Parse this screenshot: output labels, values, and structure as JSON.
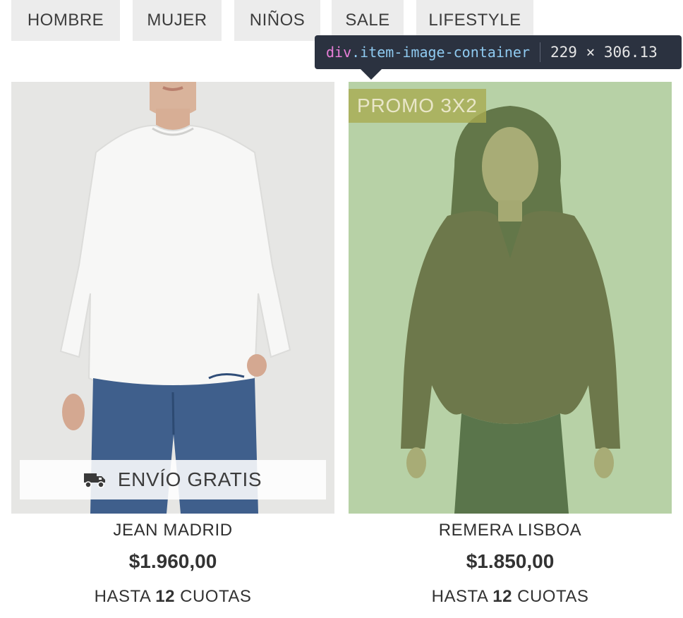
{
  "nav": {
    "items": [
      {
        "label": "HOMBRE"
      },
      {
        "label": "MUJER"
      },
      {
        "label": "NIÑOS"
      },
      {
        "label": "SALE"
      },
      {
        "label": "LIFESTYLE"
      }
    ]
  },
  "devtools": {
    "tag": "div",
    "class_name": ".item-image-container",
    "size": "229 × 306.13",
    "highlight_color": "#8bbe6e"
  },
  "products": [
    {
      "name": "JEAN MADRID",
      "price": "$1.960,00",
      "cuotas_prefix": "HASTA",
      "cuotas_count": "12",
      "cuotas_suffix": "CUOTAS",
      "envio": "ENVÍO GRATIS",
      "envio_icon": "truck-icon"
    },
    {
      "name": "REMERA LISBOA",
      "price": "$1.850,00",
      "cuotas_prefix": "HASTA",
      "cuotas_count": "12",
      "cuotas_suffix": "CUOTAS",
      "badge": "PROMO 3X2"
    }
  ]
}
